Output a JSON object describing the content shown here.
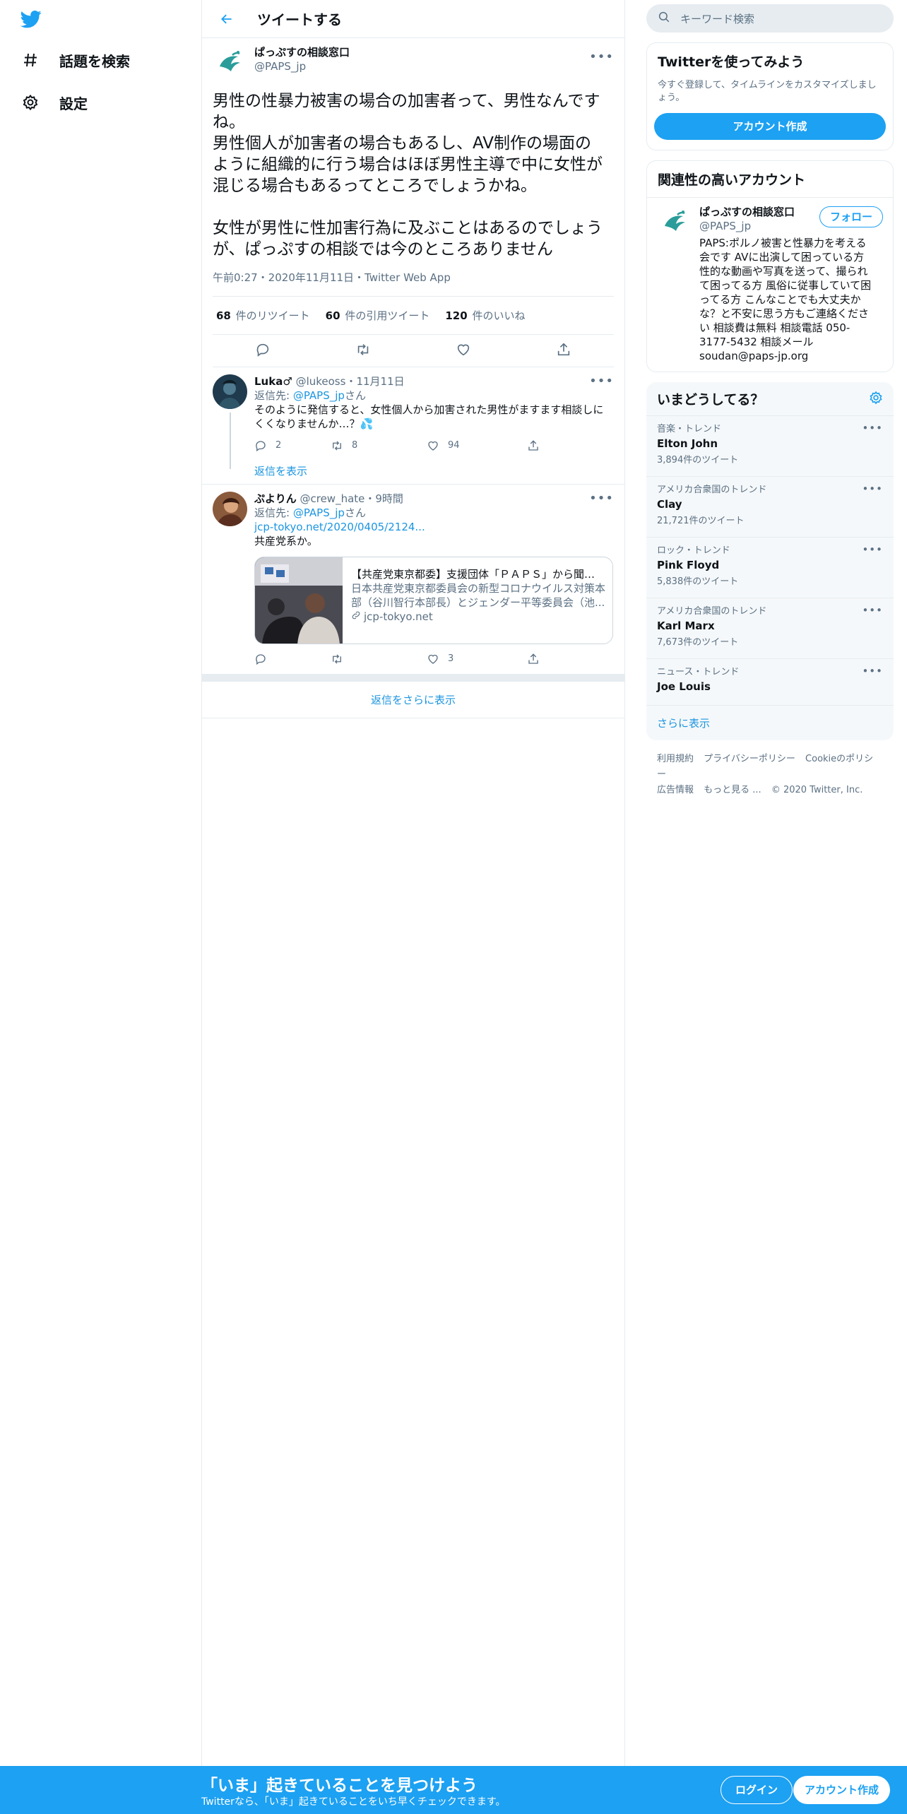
{
  "nav": {
    "explore": "話題を検索",
    "settings": "設定"
  },
  "header": {
    "title": "ツイートする"
  },
  "main_tweet": {
    "author_name": "ぱっぷすの相談窓口",
    "author_handle": "@PAPS_jp",
    "text": "男性の性暴力被害の場合の加害者って、男性なんですね。\n男性個人が加害者の場合もあるし、AV制作の場面のように組織的に行う場合はほぼ男性主導で中に女性が混じる場合もあるってところでしょうかね。\n\n女性が男性に性加害行為に及ぶことはあるのでしょうが、ぱっぷすの相談では今のところありません",
    "timestamp": "午前0:27・2020年11月11日・Twitter Web App",
    "retweets": "68",
    "retweets_label": "件のリツイート",
    "quotes": "60",
    "quotes_label": "件の引用ツイート",
    "likes": "120",
    "likes_label": "件のいいね"
  },
  "replies": [
    {
      "name": "Luka♂",
      "handle": "@lukeoss",
      "time": "・11月11日",
      "reply_prefix": "返信先: ",
      "reply_mention": "@PAPS_jp",
      "reply_suffix": "さん",
      "text": "そのように発信すると、女性個人から加害された男性がますます相談しにくくなりませんか…？💦",
      "replies": "2",
      "retweets": "8",
      "likes": "94",
      "show_replies": "返信を表示"
    },
    {
      "name": "ぷよりん",
      "handle": "@crew_hate",
      "time": "・9時間",
      "reply_prefix": "返信先: ",
      "reply_mention": "@PAPS_jp",
      "reply_suffix": "さん",
      "link": "jcp-tokyo.net/2020/0405/2124...",
      "text": "共産党系か。",
      "card_title": "【共産党東京都委】支援団体「ＰＡＰＳ」から聞き取り...",
      "card_desc": "日本共産党東京都委員会の新型コロナウイルス対策本部（谷川智行本部長）とジェンダー平等委員会（池...",
      "card_domain": "jcp-tokyo.net",
      "replies": "",
      "retweets": "",
      "likes": "3"
    }
  ],
  "more_replies": "返信をさらに表示",
  "sidebar": {
    "search_placeholder": "キーワード検索",
    "signup_title": "Twitterを使ってみよう",
    "signup_sub": "今すぐ登録して、タイムラインをカスタマイズしましょう。",
    "signup_button": "アカウント作成",
    "related_title": "関連性の高いアカウント",
    "related": {
      "name": "ぱっぷすの相談窓口",
      "handle": "@PAPS_jp",
      "follow": "フォロー",
      "bio": "PAPS:ポルノ被害と性暴力を考える会です AVに出演して困っている方 性的な動画や写真を送って、撮られて困ってる方 風俗に従事していて困ってる方 こんなことでも大丈夫かな？と不安に思う方もご連絡ください 相談費は無料 相談電話 050-3177-5432 相談メール soudan@paps-jp.org"
    },
    "trends_title": "いまどうしてる？",
    "trends": [
      {
        "category": "音楽・トレンド",
        "name": "Elton John",
        "count": "3,894件のツイート"
      },
      {
        "category": "アメリカ合衆国のトレンド",
        "name": "Clay",
        "count": "21,721件のツイート"
      },
      {
        "category": "ロック・トレンド",
        "name": "Pink Floyd",
        "count": "5,838件のツイート"
      },
      {
        "category": "アメリカ合衆国のトレンド",
        "name": "Karl Marx",
        "count": "7,673件のツイート"
      },
      {
        "category": "ニュース・トレンド",
        "name": "Joe Louis",
        "count": ""
      }
    ],
    "show_more": "さらに表示",
    "footer": [
      "利用規約",
      "プライバシーポリシー",
      "Cookieのポリシー",
      "広告情報",
      "もっと見る ...",
      "© 2020 Twitter, Inc."
    ]
  },
  "bottom_bar": {
    "title": "「いま」起きていることを見つけよう",
    "subtitle": "Twitterなら、「いま」起きていることをいち早くチェックできます。",
    "login": "ログイン",
    "signup": "アカウント作成"
  },
  "colors": {
    "accent": "#1da1f2",
    "link": "#1b95e0",
    "muted": "#5b7083"
  }
}
